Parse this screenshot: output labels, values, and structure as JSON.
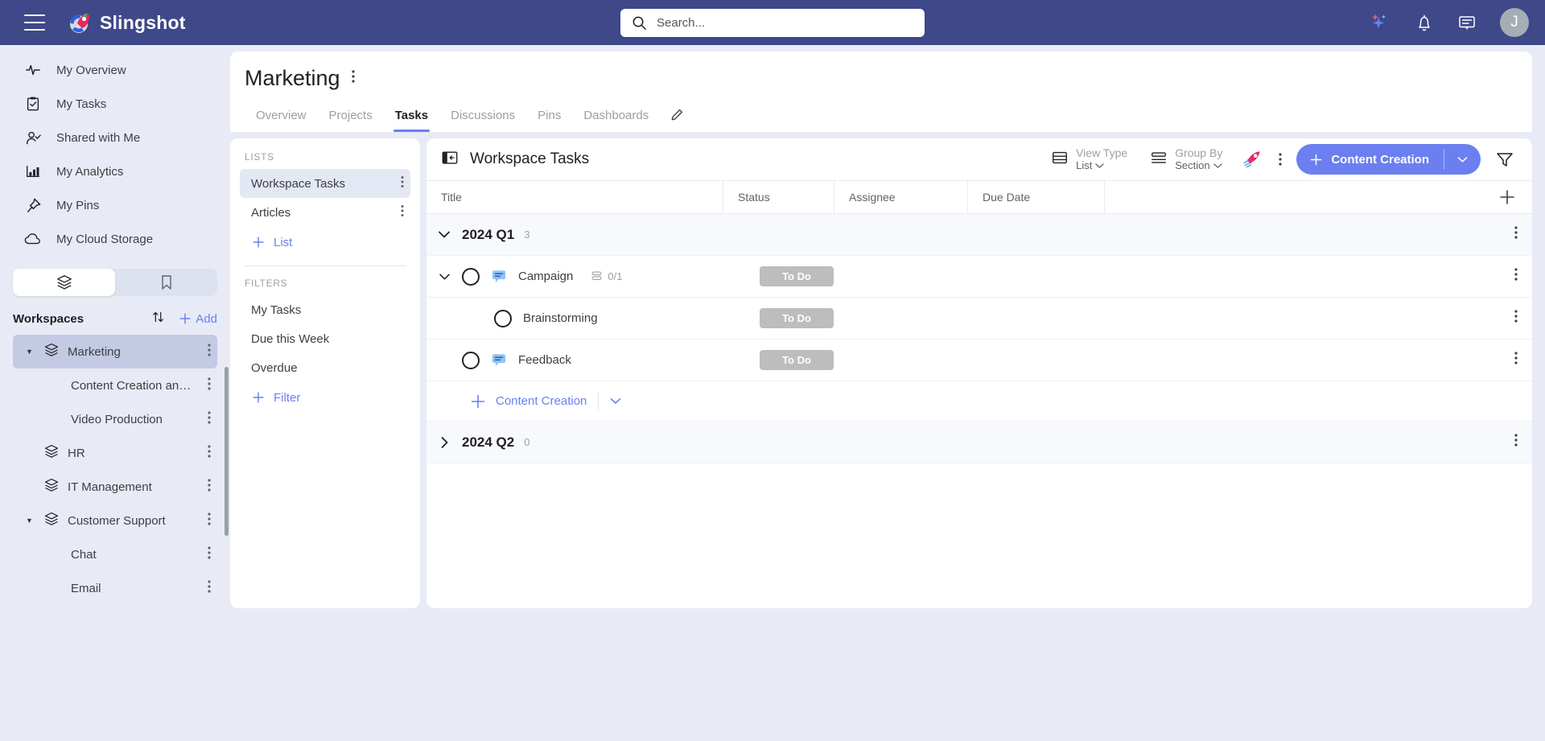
{
  "topbar": {
    "menu_icon": "hamburger-icon",
    "brand": "Slingshot",
    "search": {
      "value": "",
      "placeholder": "Search..."
    },
    "icons": [
      "ai-sparkle-icon",
      "bell-icon",
      "chat-icon"
    ],
    "avatar_initial": "J"
  },
  "sidebar": {
    "nav": [
      {
        "label": "My Overview",
        "icon": "activity-icon"
      },
      {
        "label": "My Tasks",
        "icon": "clipboard-check-icon"
      },
      {
        "label": "Shared with Me",
        "icon": "person-check-icon"
      },
      {
        "label": "My Analytics",
        "icon": "bar-chart-icon"
      },
      {
        "label": "My Pins",
        "icon": "pin-icon"
      },
      {
        "label": "My Cloud Storage",
        "icon": "cloud-icon"
      }
    ],
    "toggle": {
      "left_icon": "layers-icon",
      "right_icon": "bookmark-icon"
    },
    "workspaces_title": "Workspaces",
    "sort_icon": "sort-arrows-icon",
    "add_label": "Add",
    "workspaces": [
      {
        "label": "Marketing",
        "selected": true,
        "expanded": true,
        "children": [
          {
            "label": "Content Creation an…"
          },
          {
            "label": "Video Production"
          }
        ]
      },
      {
        "label": "HR",
        "selected": false,
        "expanded": false,
        "children": []
      },
      {
        "label": "IT Management",
        "selected": false,
        "expanded": false,
        "children": []
      },
      {
        "label": "Customer Support",
        "selected": false,
        "expanded": true,
        "children": [
          {
            "label": "Chat"
          },
          {
            "label": "Email"
          }
        ]
      }
    ]
  },
  "page": {
    "title": "Marketing",
    "tabs": [
      {
        "label": "Overview",
        "active": false
      },
      {
        "label": "Projects",
        "active": false
      },
      {
        "label": "Tasks",
        "active": true
      },
      {
        "label": "Discussions",
        "active": false
      },
      {
        "label": "Pins",
        "active": false
      },
      {
        "label": "Dashboards",
        "active": false
      }
    ],
    "edit_icon": "pencil-icon"
  },
  "lists_panel": {
    "lists_label": "LISTS",
    "lists": [
      {
        "label": "Workspace Tasks",
        "selected": true
      },
      {
        "label": "Articles",
        "selected": false
      }
    ],
    "add_list_label": "List",
    "filters_label": "FILTERS",
    "filters": [
      {
        "label": "My Tasks"
      },
      {
        "label": "Due this Week"
      },
      {
        "label": "Overdue"
      }
    ],
    "add_filter_label": "Filter"
  },
  "task_panel": {
    "collapse_icon": "panel-collapse-icon",
    "title": "Workspace Tasks",
    "view_type": {
      "label": "View Type",
      "value": "List",
      "icon": "view-list-icon"
    },
    "group_by": {
      "label": "Group By",
      "value": "Section",
      "icon": "group-by-icon"
    },
    "boost_icon": "rocket-icon",
    "more_icon": "more-vertical-icon",
    "cta": {
      "label": "Content Creation",
      "plus": "plus-icon",
      "caret": "chevron-down-icon",
      "color": "#6b7ff0"
    },
    "filter_icon": "filter-icon",
    "columns": [
      "Title",
      "Status",
      "Assignee",
      "Due Date"
    ],
    "add_column_icon": "plus-icon",
    "groups": [
      {
        "name": "2024 Q1",
        "count": "3",
        "expanded": true,
        "rows": [
          {
            "title": "Campaign",
            "status": "To Do",
            "assignee": "",
            "due_date": "",
            "has_chat": true,
            "has_caret": true,
            "indent": 0,
            "subtask_count": "0/1"
          },
          {
            "title": "Brainstorming",
            "status": "To Do",
            "assignee": "",
            "due_date": "",
            "has_chat": false,
            "has_caret": false,
            "indent": 1,
            "subtask_count": ""
          },
          {
            "title": "Feedback",
            "status": "To Do",
            "assignee": "",
            "due_date": "",
            "has_chat": true,
            "has_caret": false,
            "indent": 0,
            "subtask_count": ""
          }
        ],
        "add_row_label": "Content Creation"
      },
      {
        "name": "2024 Q2",
        "count": "0",
        "expanded": false,
        "rows": [],
        "add_row_label": ""
      }
    ]
  },
  "colors": {
    "brand_bar": "#3f4889",
    "accent": "#6b7ff0",
    "status_todo_bg": "#bdbdbd",
    "page_bg": "#e8ebf5"
  }
}
